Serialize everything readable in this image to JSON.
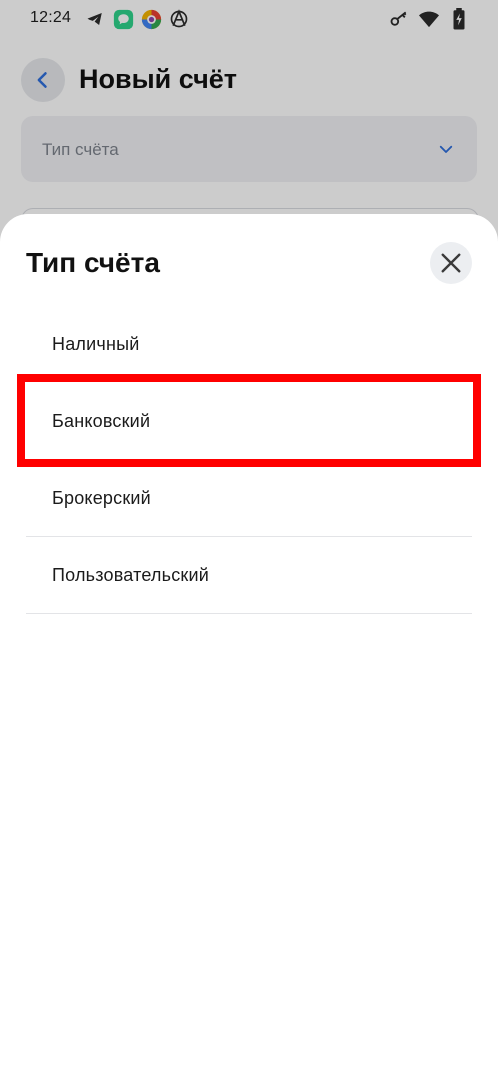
{
  "status_bar": {
    "time": "12:24",
    "left_icons": [
      "telegram-icon",
      "chat-icon",
      "colorful-app-icon",
      "anarchy-icon"
    ],
    "right_icons": [
      "key-icon",
      "wifi-icon",
      "battery-icon"
    ]
  },
  "header": {
    "title": "Новый счёт",
    "back_icon": "chevron-left-icon"
  },
  "form": {
    "type_field_placeholder": "Тип счёта",
    "type_field_icon": "chevron-down-icon"
  },
  "sheet": {
    "title": "Тип счёта",
    "close_icon": "close-icon",
    "options": [
      {
        "label": "Наличный"
      },
      {
        "label": "Банковский",
        "highlighted": true
      },
      {
        "label": "Брокерский"
      },
      {
        "label": "Пользовательский"
      }
    ]
  },
  "colors": {
    "accent": "#2f6fdb",
    "highlight": "#ff0000",
    "scrim": "rgba(0,0,0,0.20)"
  }
}
